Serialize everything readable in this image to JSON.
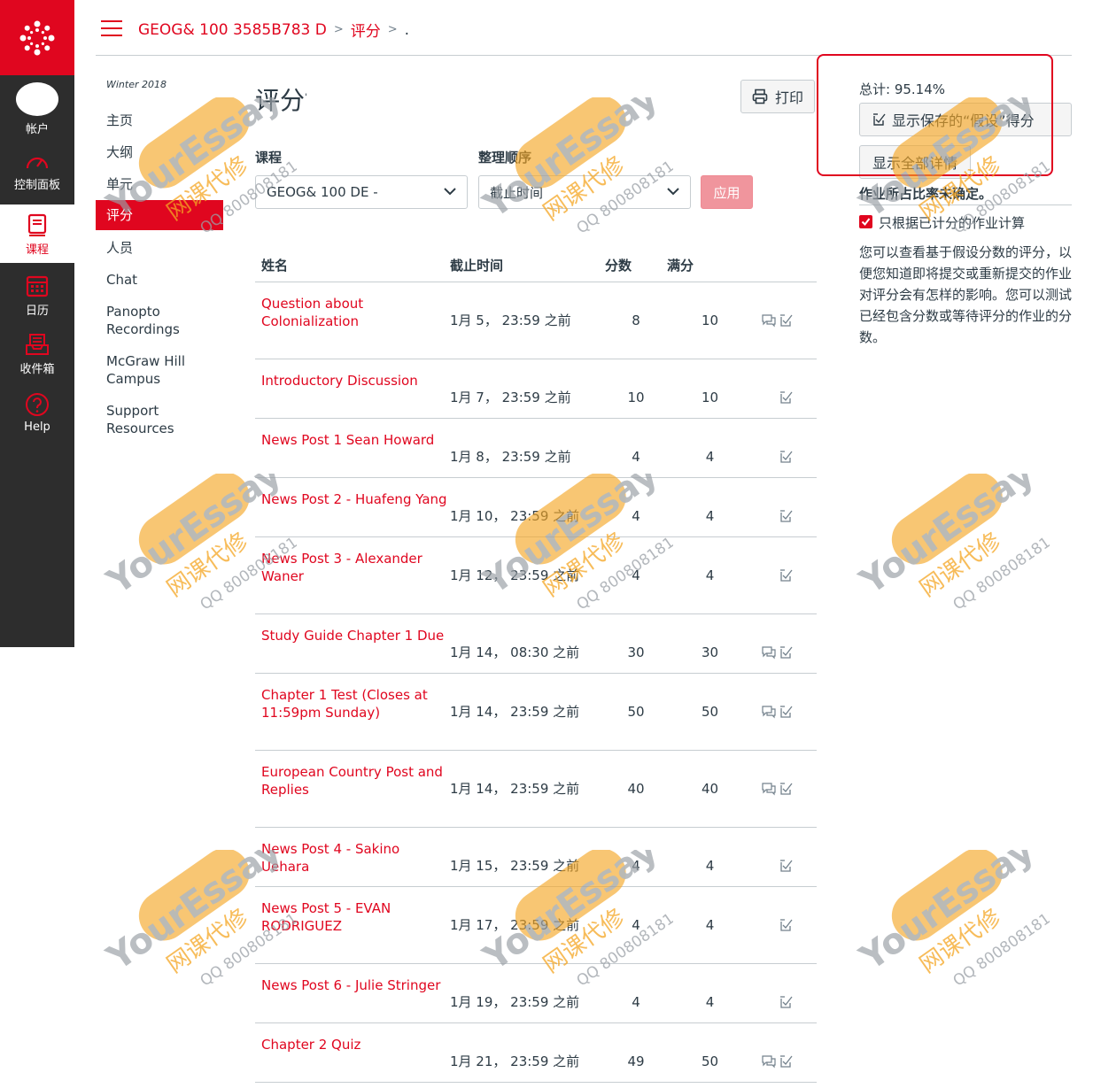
{
  "global_nav": {
    "account": "帐户",
    "dashboard": "控制面板",
    "courses": "课程",
    "calendar": "日历",
    "inbox": "收件箱",
    "help": "Help"
  },
  "breadcrumb": {
    "course": "GEOG& 100 3585B783 D",
    "section": "评分",
    "current": "."
  },
  "course_nav": {
    "term": "Winter 2018",
    "items": [
      "主页",
      "大纲",
      "单元",
      "评分",
      "人员",
      "Chat",
      "Panopto Recordings",
      "McGraw Hill Campus",
      "Support Resources"
    ]
  },
  "page": {
    "title": "评分",
    "title_suffix": "'",
    "print_label": "打印",
    "course_label": "课程",
    "course_value": "GEOG& 100 DE -",
    "order_label": "整理顺序",
    "order_value": "截止时间",
    "apply_label": "应用"
  },
  "table": {
    "headers": [
      "姓名",
      "截止时间",
      "分数",
      "满分"
    ],
    "rows": [
      {
        "name": "Question about Colonialization",
        "due": "1月 5， 23:59 之前",
        "score": "8",
        "max": "10",
        "comment": true
      },
      {
        "name": "Introductory Discussion",
        "due": "1月 7， 23:59 之前",
        "score": "10",
        "max": "10",
        "comment": false
      },
      {
        "name": "News Post 1 Sean Howard",
        "due": "1月 8， 23:59 之前",
        "score": "4",
        "max": "4",
        "comment": false
      },
      {
        "name": "News Post 2 - Huafeng Yang",
        "due": "1月 10， 23:59 之前",
        "score": "4",
        "max": "4",
        "comment": false
      },
      {
        "name": "News Post 3 - Alexander Waner",
        "due": "1月 12， 23:59 之前",
        "score": "4",
        "max": "4",
        "comment": false
      },
      {
        "name": "Study Guide Chapter 1 Due",
        "due": "1月 14， 08:30 之前",
        "score": "30",
        "max": "30",
        "comment": true
      },
      {
        "name": "Chapter 1 Test (Closes at 11:59pm Sunday)",
        "due": "1月 14， 23:59 之前",
        "score": "50",
        "max": "50",
        "comment": true
      },
      {
        "name": "European Country Post and Replies",
        "due": "1月 14， 23:59 之前",
        "score": "40",
        "max": "40",
        "comment": true
      },
      {
        "name": "News Post 4 - Sakino Uehara",
        "due": "1月 15， 23:59 之前",
        "score": "4",
        "max": "4",
        "comment": false
      },
      {
        "name": "News Post 5 - EVAN RODRIGUEZ",
        "due": "1月 17， 23:59 之前",
        "score": "4",
        "max": "4",
        "comment": false
      },
      {
        "name": "News Post 6 - Julie Stringer",
        "due": "1月 19， 23:59 之前",
        "score": "4",
        "max": "4",
        "comment": false
      },
      {
        "name": "Chapter 2 Quiz",
        "due": "1月 21， 23:59 之前",
        "score": "49",
        "max": "50",
        "comment": true
      }
    ]
  },
  "sidebar": {
    "total": "总计: 95.14%",
    "show_whatif": "显示保存的“假设”得分",
    "show_all_details": "显示全部详情",
    "weight_note": "作业所占比率未确定。",
    "checkbox_label": "只根据已计分的作业计算",
    "help_text": "您可以查看基于假设分数的评分，以便您知道即将提交或重新提交的作业对评分会有怎样的影响。您可以测试已经包含分数或等待评分的作业的分数。"
  },
  "watermark": {
    "brand": "YourEssay",
    "tagline": "网课代修",
    "qq": "QQ 800808181"
  },
  "colors": {
    "brand_red": "#e0061f",
    "nav_dark": "#2d2d2d",
    "watermark_orange": "#f5a623"
  }
}
